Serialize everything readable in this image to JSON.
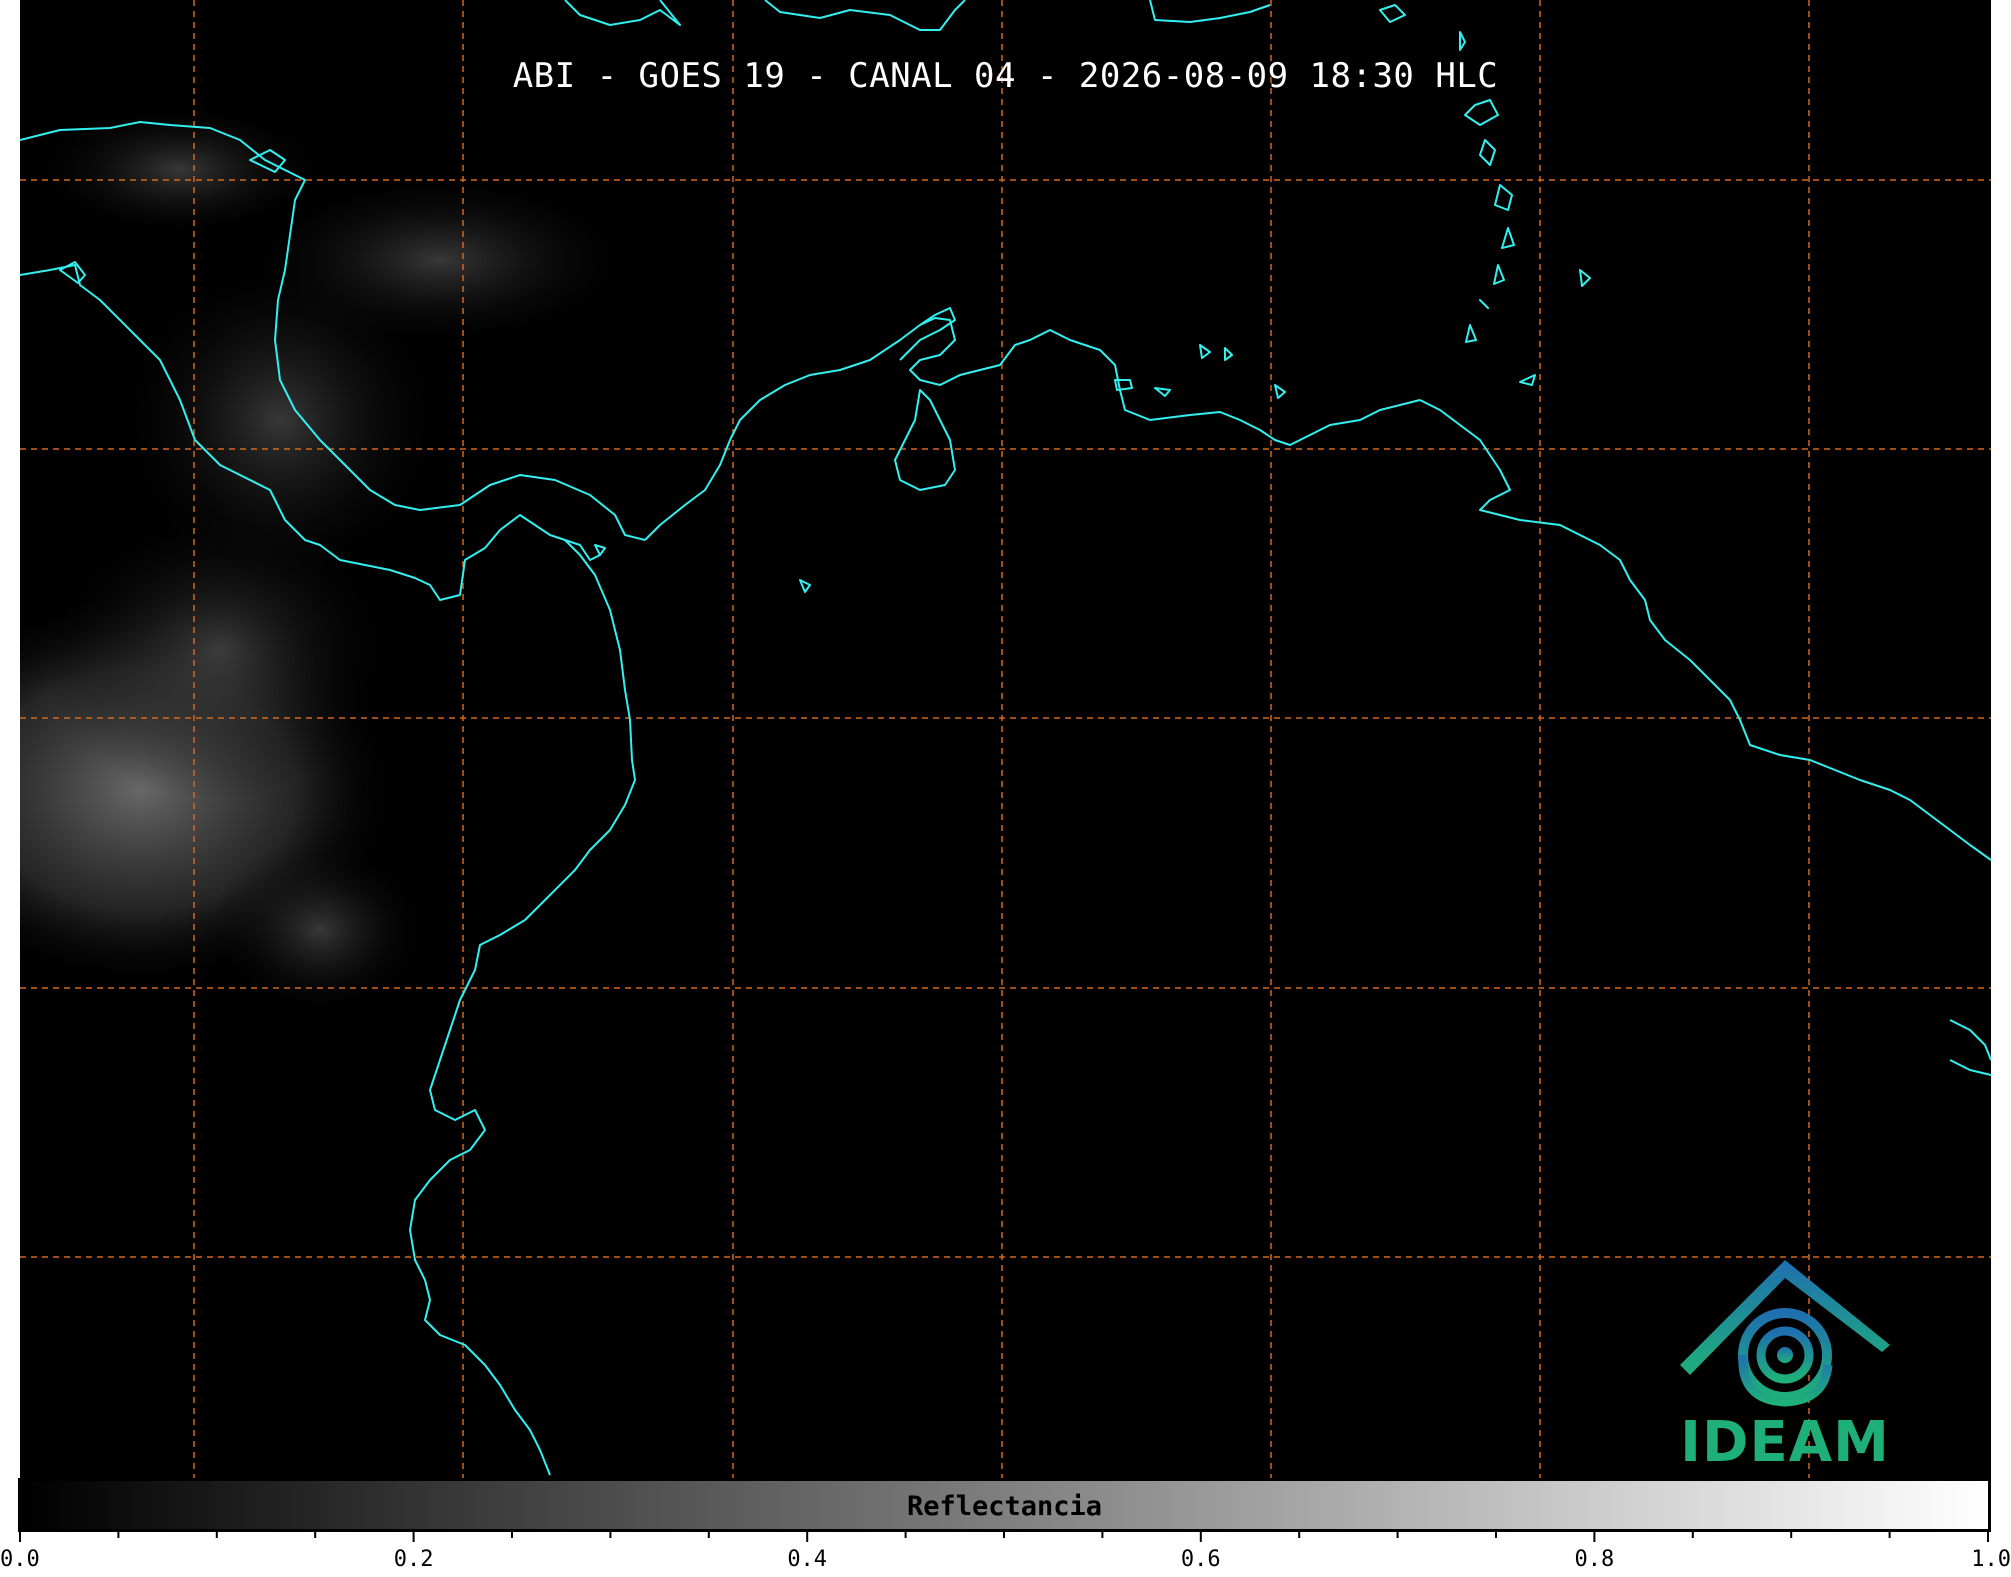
{
  "title": "ABI - GOES 19 - CANAL 04 - 2026-08-09 18:30 HLC",
  "colors": {
    "background": "#000000",
    "coastline": "#33f0f0",
    "gridline": "#d2691e",
    "logo_primary": "#1fb07a",
    "logo_secondary": "#1f6fb0"
  },
  "gridlines": {
    "style": "dashed",
    "count_vertical": 7,
    "count_horizontal": 5
  },
  "colorbar": {
    "label": "Reflectancia",
    "min": 0.0,
    "max": 1.0,
    "colormap": "gray",
    "tick_labels": [
      "0.0",
      "0.2",
      "0.4",
      "0.6",
      "0.8",
      "1.0"
    ],
    "major_ticks": [
      0.0,
      0.2,
      0.4,
      0.6,
      0.8,
      1.0
    ],
    "minor_step": 0.05
  },
  "logo": {
    "icon": "ideam-mountain-swirl-icon",
    "wordmark": "IDEAM"
  }
}
